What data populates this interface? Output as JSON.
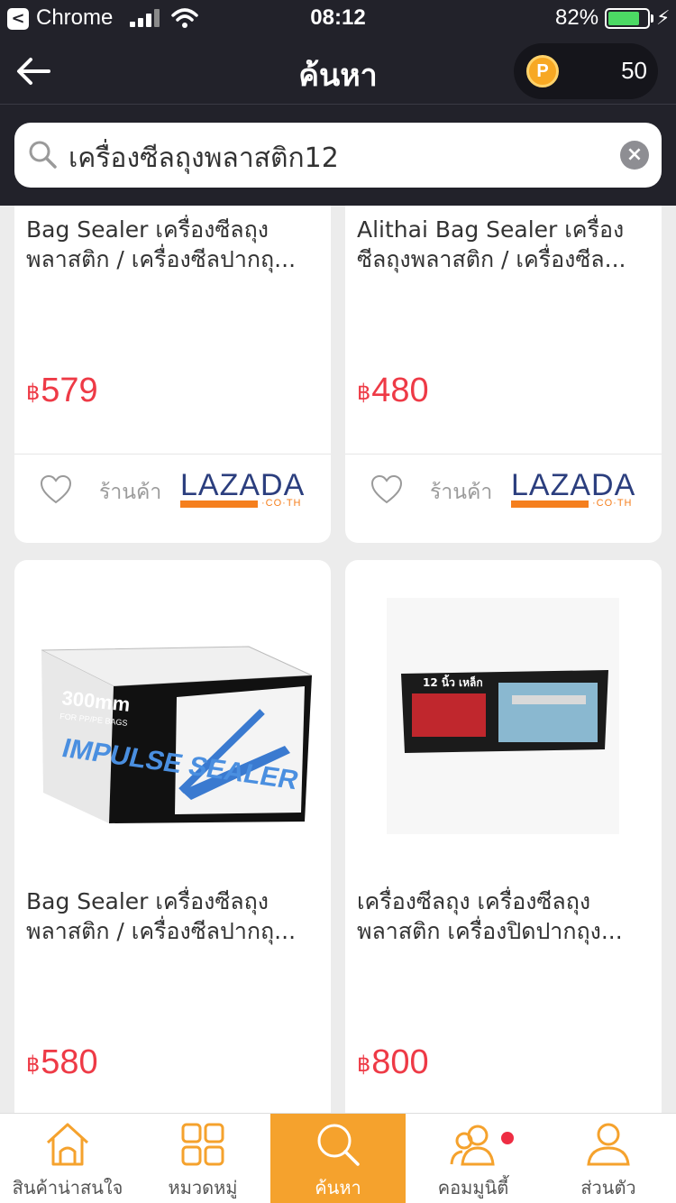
{
  "status_bar": {
    "back_app_glyph": "<",
    "app_name": "Chrome",
    "time": "08:12",
    "battery_percent": "82%",
    "battery_level": 0.82
  },
  "header": {
    "title": "ค้นหา",
    "points_badge": "P",
    "points": "50",
    "back_icon": "arrow-left-icon"
  },
  "search": {
    "value": "เครื่องซีลถุงพลาสติก12",
    "clear_glyph": "×"
  },
  "products": [
    {
      "name": "Bag Sealer เครื่องซีลถุงพลาสติก / เครื่องซีลปากถุ...",
      "currency": "฿",
      "price": "579",
      "shop_label": "ร้านค้า",
      "store": "LAZADA",
      "store_domain": "·CO·TH"
    },
    {
      "name": "Alithai Bag Sealer เครื่องซีลถุงพลาสติก / เครื่องซีล...",
      "currency": "฿",
      "price": "480",
      "shop_label": "ร้านค้า",
      "store": "LAZADA",
      "store_domain": "·CO·TH"
    },
    {
      "name": "Bag Sealer เครื่องซีลถุงพลาสติก / เครื่องซีลปากถุ...",
      "currency": "฿",
      "price": "580",
      "image_text_1": "300mm",
      "image_text_2": "FOR PP/PE BAGS",
      "image_text_3": "IMPULSE SEALER"
    },
    {
      "name": "เครื่องซีลถุง เครื่องซีลถุงพลาสติก เครื่องปิดปากถุง...",
      "currency": "฿",
      "price": "800",
      "image_text_1": "12 นิ้ว เหล็ก"
    }
  ],
  "tabs": [
    {
      "label": "สินค้าน่าสนใจ",
      "icon": "home-icon"
    },
    {
      "label": "หมวดหมู่",
      "icon": "grid-icon"
    },
    {
      "label": "ค้นหา",
      "icon": "search-icon"
    },
    {
      "label": "คอมมูนิตี้",
      "icon": "community-icon"
    },
    {
      "label": "ส่วนตัว",
      "icon": "profile-icon"
    }
  ],
  "colors": {
    "header_bg": "#22222a",
    "price": "#ee3a46",
    "accent": "#f5a22d",
    "lazada_blue": "#2b3e7e",
    "lazada_orange": "#f57f1e"
  }
}
